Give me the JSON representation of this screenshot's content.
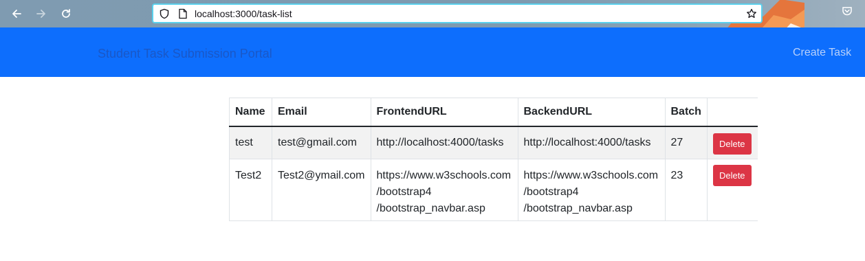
{
  "browser": {
    "url": "localhost:3000/task-list"
  },
  "navbar": {
    "brand": "Student Task Submission Portal",
    "create_link": "Create Task"
  },
  "table": {
    "headers": [
      "Name",
      "Email",
      "FrontendURL",
      "BackendURL",
      "Batch",
      ""
    ],
    "rows": [
      {
        "name": "test",
        "email": "test@gmail.com",
        "frontend": [
          "http://localhost:4000/tasks"
        ],
        "backend": [
          "http://localhost:4000/tasks"
        ],
        "batch": "27",
        "action": "Delete"
      },
      {
        "name": "Test2",
        "email": "Test2@ymail.com",
        "frontend": [
          "https://www.w3schools.com",
          "/bootstrap4",
          "/bootstrap_navbar.asp"
        ],
        "backend": [
          "https://www.w3schools.com",
          "/bootstrap4",
          "/bootstrap_navbar.asp"
        ],
        "batch": "23",
        "action": "Delete"
      }
    ]
  },
  "colors": {
    "navbar_bg": "#0d6efd",
    "delete_button": "#dc3545"
  }
}
